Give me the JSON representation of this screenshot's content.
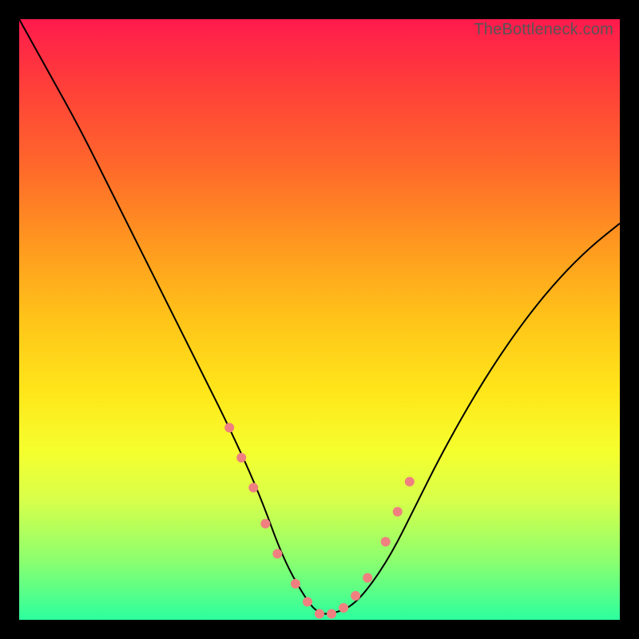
{
  "watermark": "TheBottleneck.com",
  "chart_data": {
    "type": "line",
    "title": "",
    "xlabel": "",
    "ylabel": "",
    "xlim": [
      0,
      100
    ],
    "ylim": [
      0,
      100
    ],
    "grid": false,
    "legend": false,
    "series": [
      {
        "name": "bottleneck-curve",
        "x": [
          0,
          5,
          10,
          15,
          20,
          25,
          30,
          35,
          40,
          44,
          48,
          50,
          52,
          55,
          58,
          62,
          66,
          70,
          75,
          80,
          85,
          90,
          95,
          100
        ],
        "y": [
          100,
          91,
          82,
          72,
          62,
          52,
          42,
          32,
          21,
          10,
          3,
          1,
          1,
          2,
          5,
          11,
          19,
          27,
          36,
          44,
          51,
          57,
          62,
          66
        ]
      }
    ],
    "marker_series": {
      "name": "highlight-dots",
      "color": "#f08080",
      "x": [
        35,
        37,
        39,
        41,
        43,
        46,
        48,
        50,
        52,
        54,
        56,
        58,
        61,
        63,
        65
      ],
      "y": [
        32,
        27,
        22,
        16,
        11,
        6,
        3,
        1,
        1,
        2,
        4,
        7,
        13,
        18,
        23
      ]
    },
    "background": "rainbow-vertical"
  }
}
